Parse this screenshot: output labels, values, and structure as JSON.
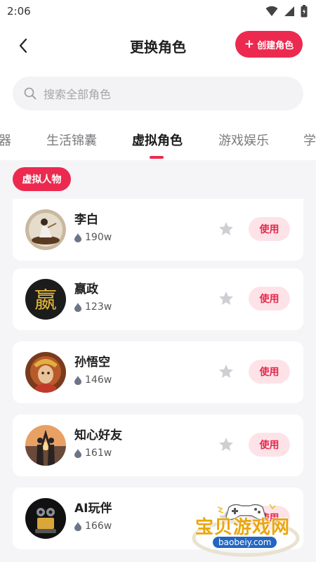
{
  "status_bar": {
    "time": "2:06"
  },
  "header": {
    "title": "更换角色",
    "create_button": {
      "icon": "+",
      "label": "创建角色"
    }
  },
  "search": {
    "placeholder": "搜索全部角色"
  },
  "tabs": [
    {
      "label": "器",
      "active": false
    },
    {
      "label": "生活锦囊",
      "active": false
    },
    {
      "label": "虚拟角色",
      "active": true
    },
    {
      "label": "游戏娱乐",
      "active": false
    },
    {
      "label": "学",
      "active": false
    }
  ],
  "section": {
    "tag": "虚拟人物"
  },
  "characters": [
    {
      "name": "李白",
      "heat": "190w",
      "action": "使用",
      "avatar": "poet-avatar"
    },
    {
      "name": "嬴政",
      "heat": "123w",
      "action": "使用",
      "avatar": "emperor-character-avatar",
      "avatar_glyph": "嬴"
    },
    {
      "name": "孙悟空",
      "heat": "146w",
      "action": "使用",
      "avatar": "monkey-king-avatar"
    },
    {
      "name": "知心好友",
      "heat": "161w",
      "action": "使用",
      "avatar": "friends-sunset-avatar"
    },
    {
      "name": "AI玩伴",
      "heat": "166w",
      "action": "使用",
      "avatar": "robot-avatar"
    }
  ],
  "watermark": {
    "text": "宝贝游戏网",
    "url": "baobeiy.com"
  },
  "colors": {
    "accent": "#ec2a4f",
    "use_button_bg": "#fde3e7",
    "star": "#cfcfd3"
  }
}
